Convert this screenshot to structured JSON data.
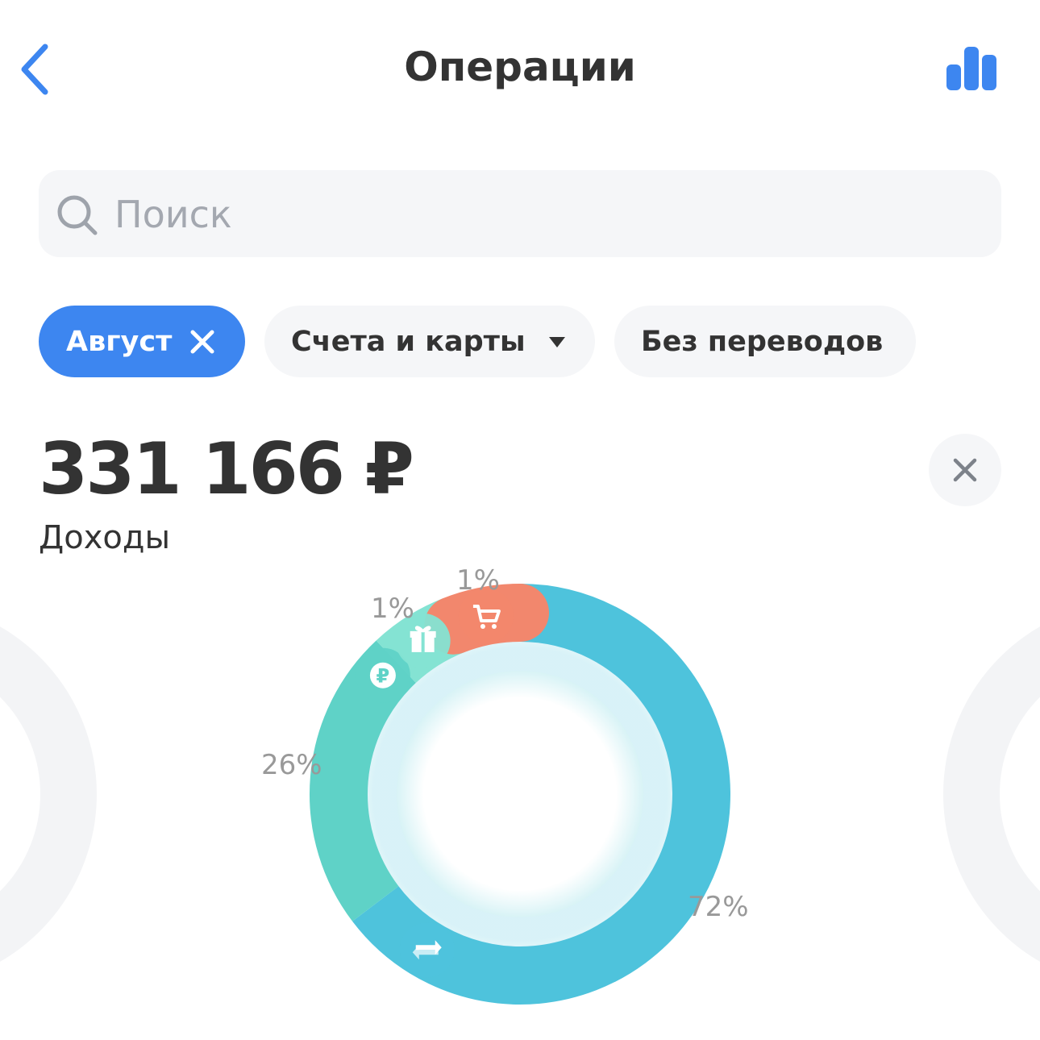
{
  "header": {
    "title": "Операции",
    "back_icon": "chevron-left-icon",
    "stats_icon": "bar-chart-icon",
    "accent": "#3d86f0"
  },
  "search": {
    "placeholder": "Поиск",
    "value": "",
    "icon": "search-icon"
  },
  "filters": {
    "month_label": "Август",
    "accounts_label": "Счета и карты",
    "transfers_label": "Без переводов",
    "active_color": "#3d86f0"
  },
  "summary": {
    "amount": "331 166 ₽",
    "label": "Доходы"
  },
  "chart_data": {
    "type": "pie",
    "title": "",
    "categories": [
      "transfers",
      "cash",
      "gifts",
      "shopping"
    ],
    "values": [
      72,
      26,
      1,
      1
    ],
    "labels": [
      "72%",
      "26%",
      "1%",
      "1%"
    ],
    "colors": [
      "#4ec3dc",
      "#5fd2c7",
      "#84e3d3",
      "#f2876d"
    ],
    "icons": [
      "arrows-exchange-icon",
      "ruble-coin-icon",
      "gift-icon",
      "cart-icon"
    ]
  }
}
